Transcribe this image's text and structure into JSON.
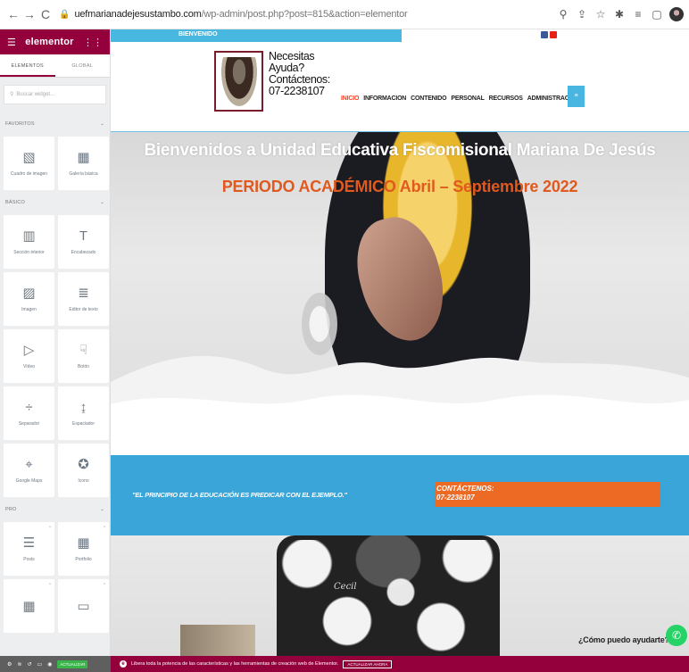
{
  "browser": {
    "back_icon": "←",
    "forward_icon": "→",
    "reload_icon": "C",
    "url_domain": "uefmarianadejesustambo.com",
    "url_path": "/wp-admin/post.php?post=815&action=elementor",
    "icons": [
      "search-icon",
      "share-icon",
      "star-icon",
      "extension-icon",
      "playlist-icon",
      "window-icon",
      "profile-icon"
    ]
  },
  "sidebar": {
    "logo": "elementor",
    "tabs": [
      "ELEMENTOS",
      "GLOBAL"
    ],
    "search_placeholder": "Buscar widget...",
    "sections": [
      {
        "title": "FAVORITOS",
        "widgets": [
          {
            "label": "Cuadro de imagen",
            "icon": "image-box-icon"
          },
          {
            "label": "Galería básica",
            "icon": "gallery-icon"
          }
        ]
      },
      {
        "title": "BÁSICO",
        "widgets": [
          {
            "label": "Sección interior",
            "icon": "inner-section-icon"
          },
          {
            "label": "Encabezado",
            "icon": "heading-icon"
          },
          {
            "label": "Imagen",
            "icon": "image-icon"
          },
          {
            "label": "Editor de texto",
            "icon": "text-editor-icon"
          },
          {
            "label": "Vídeo",
            "icon": "video-icon"
          },
          {
            "label": "Botón",
            "icon": "button-icon"
          },
          {
            "label": "Separador",
            "icon": "divider-icon"
          },
          {
            "label": "Espaciador",
            "icon": "spacer-icon"
          },
          {
            "label": "Google Maps",
            "icon": "google-maps-icon"
          },
          {
            "label": "Icono",
            "icon": "icon-widget-icon"
          }
        ]
      },
      {
        "title": "PRO",
        "widgets": [
          {
            "label": "Posts",
            "icon": "posts-icon"
          },
          {
            "label": "Portfolio",
            "icon": "portfolio-icon"
          }
        ]
      }
    ]
  },
  "bottom_bar": {
    "update_label": "ACTUALIZAR",
    "message": "Libera toda la potencia de las características y las herramientas de creación web de Elementor.",
    "cta": "ACTUALIZAR AHORA"
  },
  "page": {
    "top_strip_text": "BIENVENIDO",
    "help_text": "Necesitas Ayuda? Contáctenos: 07-2238107",
    "menu": [
      "INICIO",
      "INFORMACION",
      "CONTENIDO",
      "PERSONAL",
      "RECURSOS",
      "ADMINISTRACION"
    ],
    "hero_title": "Bienvenidos a Unidad Educativa Fiscomisional Mariana De Jesús",
    "hero_period": "PERIODO ACADÉMICO Abril – Septiembre 2022",
    "quote": "\"EL PRINCIPIO DE LA EDUCACIÓN ES PREDICAR CON EL EJEMPLO.\"",
    "contact_title": "CONTÁCTENOS:",
    "contact_phone": "07-2238107",
    "signature": "Cecil",
    "chat_text": "¿Cómo puedo ayudarte?"
  },
  "colors": {
    "elementor": "#93003c",
    "blue": "#3aa5d8",
    "orange": "#ec6a24",
    "menu_active": "#ff3c1c",
    "whatsapp": "#25d366"
  }
}
